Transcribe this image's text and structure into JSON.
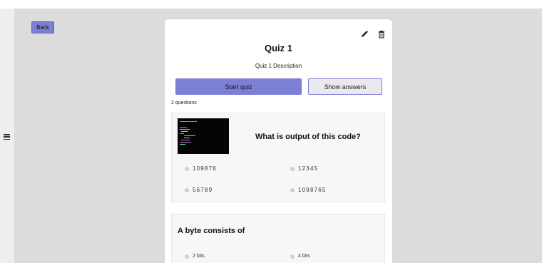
{
  "nav": {
    "back_label": "Back",
    "menu_icon": "hamburger-menu-icon"
  },
  "quiz": {
    "title": "Quiz 1",
    "description": "Quiz 1 Description",
    "start_label": "Start quiz",
    "answers_label": "Show answers",
    "question_count": "2 questions",
    "icons": {
      "edit": "pencil-icon",
      "delete": "trash-icon"
    },
    "accent_color": "#7b7fd6"
  },
  "questions": [
    {
      "text": "What is output of this code?",
      "has_code_image": true,
      "options": [
        "109876",
        "12345",
        "56789",
        "1098765"
      ]
    },
    {
      "text": "A byte consists of",
      "options": [
        "2 bits",
        "4 bits"
      ]
    }
  ]
}
